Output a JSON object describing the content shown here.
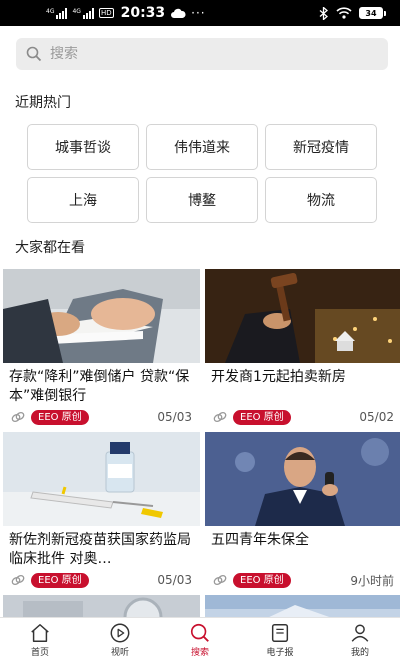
{
  "status_bar": {
    "net1": "4G",
    "net2": "4G",
    "hd": "HD",
    "time": "20:33",
    "battery": "34"
  },
  "search": {
    "placeholder": "搜索",
    "icon": "search-icon"
  },
  "hot": {
    "title": "近期热门",
    "tags": [
      "城事哲谈",
      "伟伟道来",
      "新冠疫情",
      "上海",
      "博鳌",
      "物流"
    ]
  },
  "feed": {
    "title": "大家都在看",
    "articles": [
      {
        "title": "存款“降利”难倒储户 贷款“保本”难倒银行",
        "badge": "EEO 原创",
        "date": "05/03"
      },
      {
        "title": "开发商1元起拍卖新房",
        "badge": "EEO 原创",
        "date": "05/02"
      },
      {
        "title": "新佐剂新冠疫苗获国家药监局临床批件 对奥…",
        "badge": "EEO 原创",
        "date": "05/03"
      },
      {
        "title": "五四青年朱保全",
        "badge": "EEO 原创",
        "date": "9小时前"
      }
    ]
  },
  "nav": {
    "items": [
      {
        "label": "首页",
        "icon": "home-icon"
      },
      {
        "label": "视听",
        "icon": "play-icon"
      },
      {
        "label": "搜索",
        "icon": "search-icon"
      },
      {
        "label": "电子报",
        "icon": "newspaper-icon"
      },
      {
        "label": "我的",
        "icon": "user-icon"
      }
    ],
    "active_index": 2
  },
  "colors": {
    "accent": "#c8102e",
    "badge": "#c8102e",
    "search_bg": "#ececec",
    "status_bar": "#000000"
  }
}
